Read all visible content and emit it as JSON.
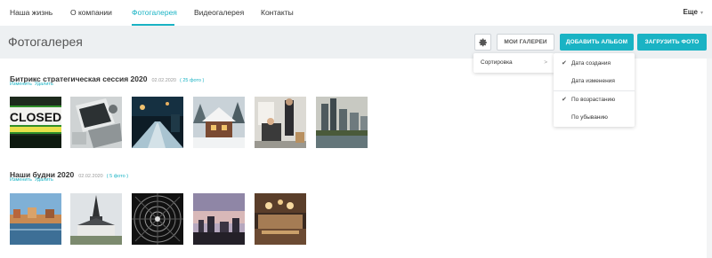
{
  "nav": {
    "items": [
      "Наша жизнь",
      "О компании",
      "Фотогалерея",
      "Видеогалерея",
      "Контакты"
    ],
    "more_label": "Еще"
  },
  "header": {
    "title": "Фотогалерея",
    "gear_icon": "gear-icon",
    "my_galleries_label": "МОИ ГАЛЕРЕИ",
    "add_album_label": "ДОБАВИТЬ АЛЬБОМ",
    "upload_photo_label": "ЗАГРУЗИТЬ ФОТО"
  },
  "colors": {
    "accent": "#1ab3c4",
    "header_bg": "#edf0f2"
  },
  "albums": [
    {
      "title": "Битрикс стратегическая сессия 2020",
      "date": "02.02.2020",
      "count": "( 25 фото )",
      "edit_label": "Изменить",
      "delete_label": "Удалить",
      "photos": [
        "closed-sign",
        "desk-laptop",
        "night-street",
        "snowy-cabin",
        "office-people",
        "river-skyline"
      ]
    },
    {
      "title": "Наши будни 2020",
      "date": "02.02.2020",
      "count": "( 5 фото )",
      "edit_label": "Изменить",
      "delete_label": "Удалить",
      "photos": [
        "canal-houses",
        "church-spire",
        "dome-interior",
        "city-dusk",
        "ballroom"
      ]
    }
  ],
  "menu": {
    "sort_label": "Сортировка",
    "sort_arrow": ">",
    "options": [
      {
        "label": "Дата создания",
        "checked": true
      },
      {
        "label": "Дата изменения",
        "checked": false
      },
      {
        "label": "По возрастанию",
        "checked": true
      },
      {
        "label": "По убыванию",
        "checked": false
      }
    ],
    "check_glyph": "✔"
  }
}
